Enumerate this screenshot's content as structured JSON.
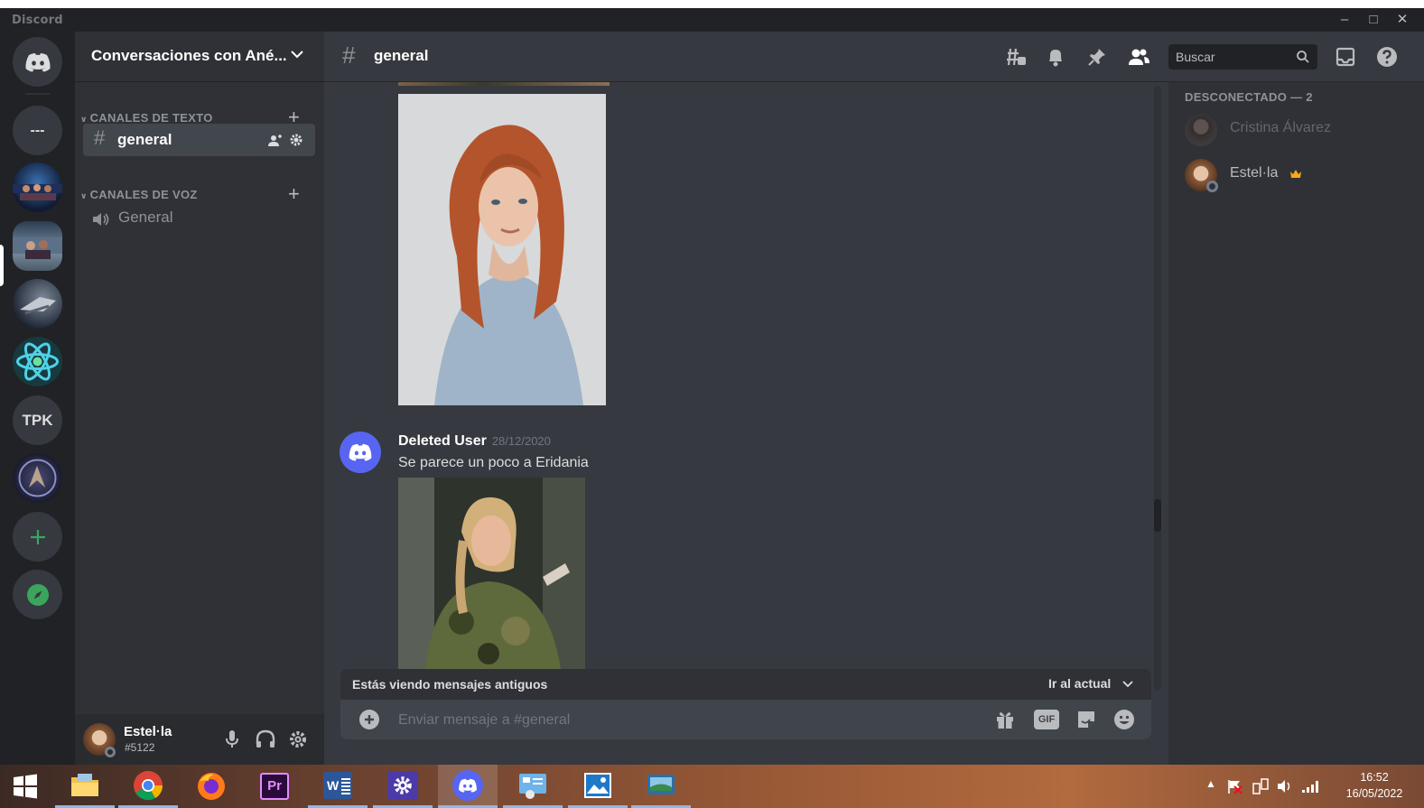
{
  "window": {
    "app_name": "Discord"
  },
  "servers": [
    {
      "name": "home",
      "icon": "discord-logo-icon"
    },
    {
      "name": "---",
      "label": "---"
    },
    {
      "name": "server-stage",
      "icon": "server-image"
    },
    {
      "name": "server-active",
      "icon": "server-image"
    },
    {
      "name": "server-ship",
      "icon": "server-image"
    },
    {
      "name": "server-atom",
      "icon": "atom-icon"
    },
    {
      "name": "TPK",
      "label": "TPK"
    },
    {
      "name": "server-dragon",
      "icon": "server-image"
    },
    {
      "name": "add-server",
      "icon": "plus-icon"
    },
    {
      "name": "explore",
      "icon": "compass-icon"
    }
  ],
  "guild": {
    "name": "Conversaciones con Ané..."
  },
  "categories": {
    "text": "CANALES DE TEXTO",
    "voice": "CANALES DE VOZ"
  },
  "channels": {
    "text_active": "general",
    "voice": "General"
  },
  "user_panel": {
    "username": "Estel·la",
    "tag": "#5122"
  },
  "topbar": {
    "channel_name": "general",
    "search_placeholder": "Buscar"
  },
  "messages": [
    {
      "author": "Deleted User",
      "timestamp": "28/12/2020",
      "text": "Se parece un poco a Eridania"
    }
  ],
  "old_messages_bar": {
    "notice": "Estás viendo mensajes antiguos",
    "jump_label": "Ir al actual"
  },
  "composer": {
    "placeholder": "Enviar mensaje a #general",
    "gif_label": "GIF"
  },
  "members": {
    "section_title": "DESCONECTADO — 2",
    "list": [
      {
        "name": "Cristina Álvarez",
        "owner": false
      },
      {
        "name": "Estel·la",
        "owner": true
      }
    ]
  },
  "taskbar": {
    "apps": [
      "start-icon",
      "file-explorer-icon",
      "chrome-icon",
      "firefox-icon",
      "premiere-icon",
      "word-icon",
      "settings-icon",
      "discord-icon",
      "control-panel-icon",
      "photos-icon",
      "screen-icon"
    ],
    "premiere_label": "Pr",
    "word_label": "W",
    "time": "16:52",
    "date": "16/05/2022"
  },
  "colors": {
    "blurple": "#5865f2",
    "green": "#3ba55d",
    "owner_crown": "#faa81a"
  }
}
